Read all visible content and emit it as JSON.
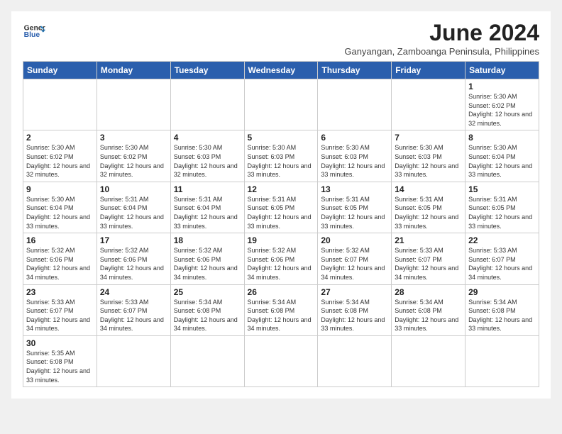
{
  "header": {
    "logo_line1": "General",
    "logo_line2": "Blue",
    "month_title": "June 2024",
    "subtitle": "Ganyangan, Zamboanga Peninsula, Philippines"
  },
  "days_of_week": [
    "Sunday",
    "Monday",
    "Tuesday",
    "Wednesday",
    "Thursday",
    "Friday",
    "Saturday"
  ],
  "weeks": [
    [
      {
        "num": "",
        "info": ""
      },
      {
        "num": "",
        "info": ""
      },
      {
        "num": "",
        "info": ""
      },
      {
        "num": "",
        "info": ""
      },
      {
        "num": "",
        "info": ""
      },
      {
        "num": "",
        "info": ""
      },
      {
        "num": "1",
        "info": "Sunrise: 5:30 AM\nSunset: 6:02 PM\nDaylight: 12 hours and 32 minutes."
      }
    ],
    [
      {
        "num": "2",
        "info": "Sunrise: 5:30 AM\nSunset: 6:02 PM\nDaylight: 12 hours and 32 minutes."
      },
      {
        "num": "3",
        "info": "Sunrise: 5:30 AM\nSunset: 6:02 PM\nDaylight: 12 hours and 32 minutes."
      },
      {
        "num": "4",
        "info": "Sunrise: 5:30 AM\nSunset: 6:03 PM\nDaylight: 12 hours and 32 minutes."
      },
      {
        "num": "5",
        "info": "Sunrise: 5:30 AM\nSunset: 6:03 PM\nDaylight: 12 hours and 33 minutes."
      },
      {
        "num": "6",
        "info": "Sunrise: 5:30 AM\nSunset: 6:03 PM\nDaylight: 12 hours and 33 minutes."
      },
      {
        "num": "7",
        "info": "Sunrise: 5:30 AM\nSunset: 6:03 PM\nDaylight: 12 hours and 33 minutes."
      },
      {
        "num": "8",
        "info": "Sunrise: 5:30 AM\nSunset: 6:04 PM\nDaylight: 12 hours and 33 minutes."
      }
    ],
    [
      {
        "num": "9",
        "info": "Sunrise: 5:30 AM\nSunset: 6:04 PM\nDaylight: 12 hours and 33 minutes."
      },
      {
        "num": "10",
        "info": "Sunrise: 5:31 AM\nSunset: 6:04 PM\nDaylight: 12 hours and 33 minutes."
      },
      {
        "num": "11",
        "info": "Sunrise: 5:31 AM\nSunset: 6:04 PM\nDaylight: 12 hours and 33 minutes."
      },
      {
        "num": "12",
        "info": "Sunrise: 5:31 AM\nSunset: 6:05 PM\nDaylight: 12 hours and 33 minutes."
      },
      {
        "num": "13",
        "info": "Sunrise: 5:31 AM\nSunset: 6:05 PM\nDaylight: 12 hours and 33 minutes."
      },
      {
        "num": "14",
        "info": "Sunrise: 5:31 AM\nSunset: 6:05 PM\nDaylight: 12 hours and 33 minutes."
      },
      {
        "num": "15",
        "info": "Sunrise: 5:31 AM\nSunset: 6:05 PM\nDaylight: 12 hours and 33 minutes."
      }
    ],
    [
      {
        "num": "16",
        "info": "Sunrise: 5:32 AM\nSunset: 6:06 PM\nDaylight: 12 hours and 34 minutes."
      },
      {
        "num": "17",
        "info": "Sunrise: 5:32 AM\nSunset: 6:06 PM\nDaylight: 12 hours and 34 minutes."
      },
      {
        "num": "18",
        "info": "Sunrise: 5:32 AM\nSunset: 6:06 PM\nDaylight: 12 hours and 34 minutes."
      },
      {
        "num": "19",
        "info": "Sunrise: 5:32 AM\nSunset: 6:06 PM\nDaylight: 12 hours and 34 minutes."
      },
      {
        "num": "20",
        "info": "Sunrise: 5:32 AM\nSunset: 6:07 PM\nDaylight: 12 hours and 34 minutes."
      },
      {
        "num": "21",
        "info": "Sunrise: 5:33 AM\nSunset: 6:07 PM\nDaylight: 12 hours and 34 minutes."
      },
      {
        "num": "22",
        "info": "Sunrise: 5:33 AM\nSunset: 6:07 PM\nDaylight: 12 hours and 34 minutes."
      }
    ],
    [
      {
        "num": "23",
        "info": "Sunrise: 5:33 AM\nSunset: 6:07 PM\nDaylight: 12 hours and 34 minutes."
      },
      {
        "num": "24",
        "info": "Sunrise: 5:33 AM\nSunset: 6:07 PM\nDaylight: 12 hours and 34 minutes."
      },
      {
        "num": "25",
        "info": "Sunrise: 5:34 AM\nSunset: 6:08 PM\nDaylight: 12 hours and 34 minutes."
      },
      {
        "num": "26",
        "info": "Sunrise: 5:34 AM\nSunset: 6:08 PM\nDaylight: 12 hours and 34 minutes."
      },
      {
        "num": "27",
        "info": "Sunrise: 5:34 AM\nSunset: 6:08 PM\nDaylight: 12 hours and 33 minutes."
      },
      {
        "num": "28",
        "info": "Sunrise: 5:34 AM\nSunset: 6:08 PM\nDaylight: 12 hours and 33 minutes."
      },
      {
        "num": "29",
        "info": "Sunrise: 5:34 AM\nSunset: 6:08 PM\nDaylight: 12 hours and 33 minutes."
      }
    ],
    [
      {
        "num": "30",
        "info": "Sunrise: 5:35 AM\nSunset: 6:08 PM\nDaylight: 12 hours and 33 minutes."
      },
      {
        "num": "",
        "info": ""
      },
      {
        "num": "",
        "info": ""
      },
      {
        "num": "",
        "info": ""
      },
      {
        "num": "",
        "info": ""
      },
      {
        "num": "",
        "info": ""
      },
      {
        "num": "",
        "info": ""
      }
    ]
  ]
}
